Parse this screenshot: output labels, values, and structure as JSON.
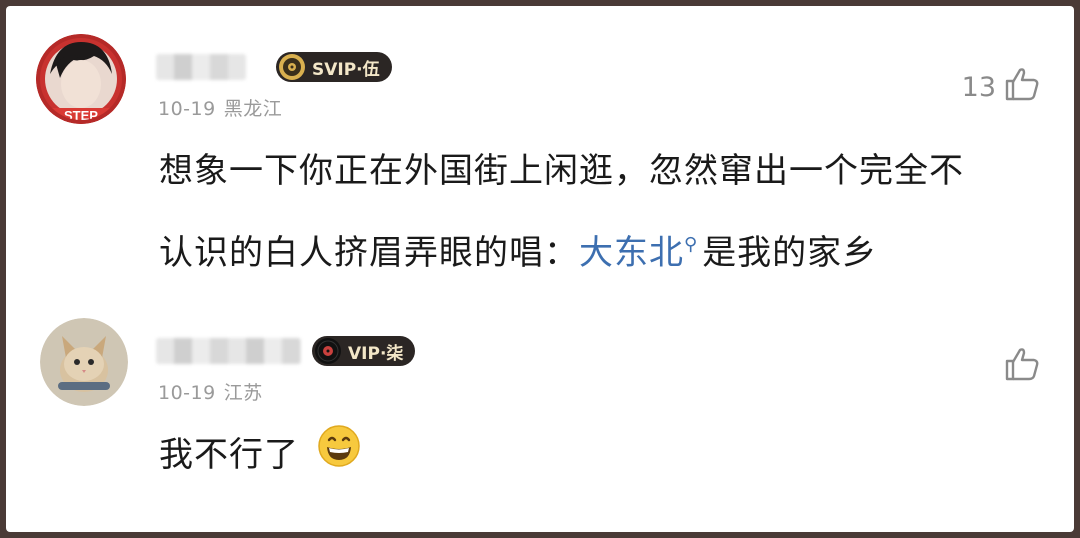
{
  "comments": [
    {
      "badge": "SVIP·伍",
      "date": "10-19",
      "location": "黑龙江",
      "likes": "13",
      "text_line1": "想象一下你正在外国街上闲逛，忽然窜出一个完全不",
      "text_line2_before": "认识的白人挤眉弄眼的唱：",
      "text_link": "大东北",
      "text_line2_after": "是我的家乡"
    },
    {
      "badge": "VIP·柒",
      "date": "10-19",
      "location": "江苏",
      "likes": "",
      "text": "我不行了"
    }
  ],
  "icons": {
    "like": "thumbs-up-icon",
    "search": "search-icon",
    "emoji": "grinning-face-emoji",
    "disc": "vinyl-disc-icon"
  },
  "colors": {
    "link": "#3d6fb0",
    "badge_bg": "#2b2624",
    "badge_text": "#f3e7c8",
    "meta": "#9a9a9a"
  }
}
